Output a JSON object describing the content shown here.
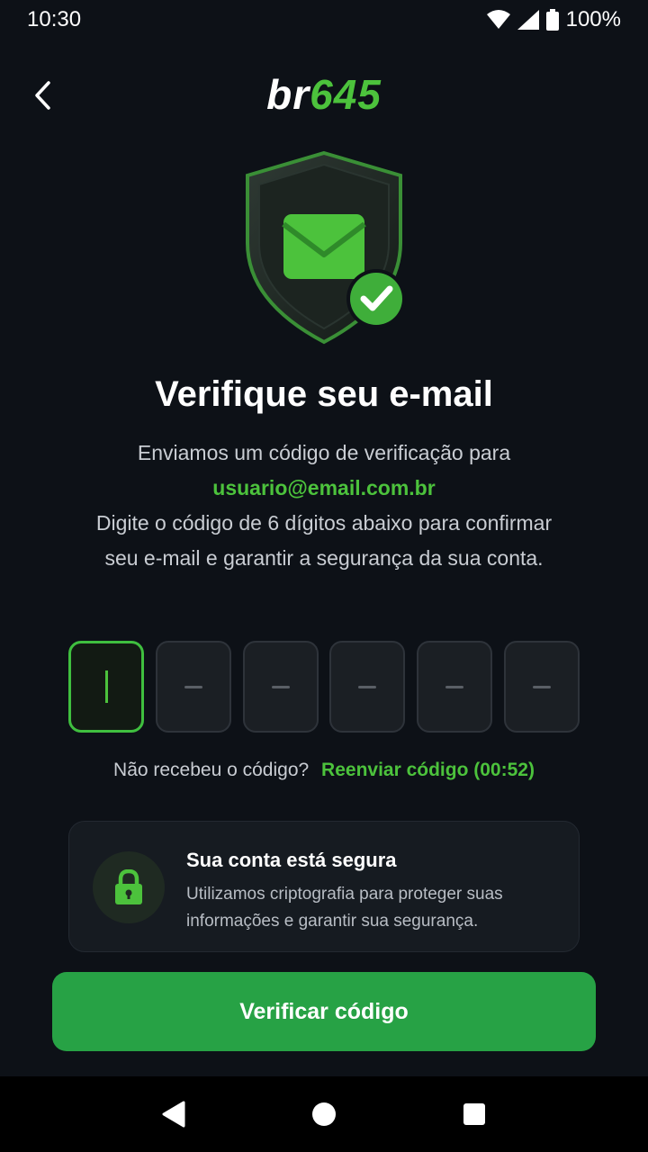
{
  "status_bar": {
    "time": "10:30",
    "battery": "100%",
    "icons": [
      "wifi-icon",
      "cellular-signal-icon",
      "battery-icon"
    ]
  },
  "header": {
    "back_icon": "chevron-left-icon",
    "logo_prefix": "br",
    "logo_suffix": "645"
  },
  "hero": {
    "icon": "shield-envelope-check-icon"
  },
  "main": {
    "title": "Verifique seu e-mail",
    "line1": "Enviamos um código de verificação para",
    "email": "usuario@email.com.br",
    "line2": "Digite o código de 6 dígitos abaixo para confirmar seu e-mail e garantir a segurança da sua conta."
  },
  "otp": {
    "digits": [
      "",
      "",
      "",
      "",
      "",
      ""
    ],
    "active_index": 0
  },
  "resend": {
    "prompt": "Não recebeu o código?",
    "link": "Reenviar código (00:52)"
  },
  "security_card": {
    "icon": "lock-icon",
    "title": "Sua conta está segura",
    "text": "Utilizamos criptografia para proteger suas informações e garantir sua segurança."
  },
  "primary_button": {
    "label": "Verificar código"
  },
  "nav": {
    "icons": [
      "back-triangle-icon",
      "home-circle-icon",
      "recents-square-icon"
    ]
  },
  "colors": {
    "background": "#0d1117",
    "accent": "#4cc23c",
    "button": "#27a245"
  }
}
